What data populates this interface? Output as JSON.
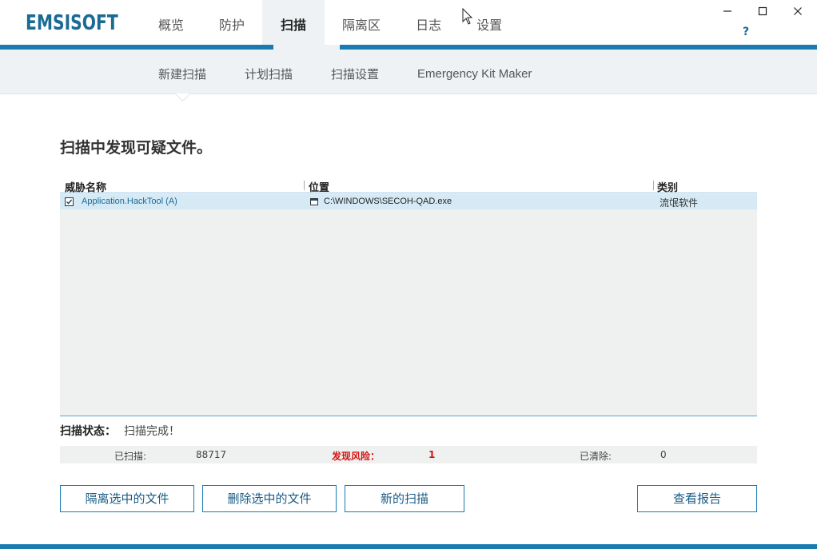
{
  "app": {
    "logo": "EMSISOFT"
  },
  "nav": {
    "items": [
      {
        "label": "概览"
      },
      {
        "label": "防护"
      },
      {
        "label": "扫描"
      },
      {
        "label": "隔离区"
      },
      {
        "label": "日志"
      },
      {
        "label": "设置"
      }
    ],
    "active_index": 2
  },
  "window": {
    "minimize": "—",
    "maximize": "☐",
    "close": "✕",
    "help": "?"
  },
  "subnav": {
    "items": [
      {
        "label": "新建扫描"
      },
      {
        "label": "计划扫描"
      },
      {
        "label": "扫描设置"
      },
      {
        "label": "Emergency Kit Maker"
      }
    ]
  },
  "main": {
    "heading": "扫描中发现可疑文件。",
    "table": {
      "columns": [
        "威胁名称",
        "位置",
        "类别"
      ],
      "rows": [
        {
          "checked": true,
          "threat": "Application.HackTool (A)",
          "location": "C:\\WINDOWS\\SECOH-QAD.exe",
          "category": "流氓软件"
        }
      ]
    },
    "status": {
      "label": "扫描状态：",
      "value": "扫描完成！"
    },
    "stats": {
      "scanned_label": "已扫描:",
      "scanned_value": "88717",
      "risks_label": "发现风险：",
      "risks_value": "1",
      "cleaned_label": "已清除:",
      "cleaned_value": "0"
    },
    "buttons": {
      "quarantine": "隔离选中的文件",
      "delete": "删除选中的文件",
      "new_scan": "新的扫描",
      "view_report": "查看报告"
    }
  },
  "colors": {
    "accent": "#1a7bb0",
    "logo": "#1a6a94",
    "risk": "#d21414",
    "row_selected": "#d6eaf6"
  }
}
